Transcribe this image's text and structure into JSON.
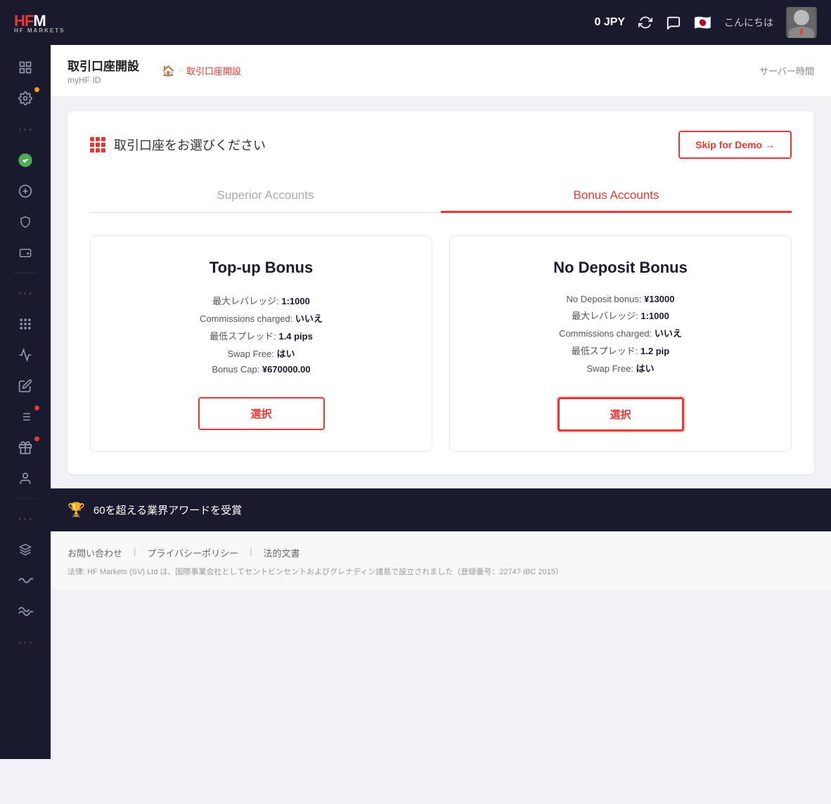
{
  "topnav": {
    "logo_hf": "HF",
    "logo_sub": "HF MARKETS",
    "balance": "0 JPY",
    "greeting": "こんにちは"
  },
  "sidebar": {
    "items": [
      {
        "icon": "📊",
        "name": "analytics-icon",
        "active": false,
        "dot": null
      },
      {
        "icon": "⚙",
        "name": "settings-icon",
        "active": false,
        "dot": "orange"
      },
      {
        "icon": "···",
        "name": "more-dots-icon",
        "active": false,
        "dot": null
      },
      {
        "icon": "🟢",
        "name": "green-account-icon",
        "active": false,
        "dot": null
      },
      {
        "icon": "◯",
        "name": "circle-icon",
        "active": false,
        "dot": null
      },
      {
        "icon": "⊙",
        "name": "lock-icon",
        "active": false,
        "dot": null
      },
      {
        "icon": "🗂",
        "name": "wallet-icon",
        "active": false,
        "dot": null
      },
      {
        "icon": "···",
        "name": "more2-icon",
        "active": false,
        "dot": null
      },
      {
        "icon": "⊞",
        "name": "grid-icon",
        "active": false,
        "dot": null
      },
      {
        "icon": "📈",
        "name": "chart-icon",
        "active": false,
        "dot": null
      },
      {
        "icon": "✏",
        "name": "edit-icon",
        "active": false,
        "dot": null
      },
      {
        "icon": "≡",
        "name": "list-icon",
        "active": false,
        "dot": "red"
      },
      {
        "icon": "🎁",
        "name": "gift-icon",
        "active": false,
        "dot": "red"
      },
      {
        "icon": "👤",
        "name": "user-icon",
        "active": false,
        "dot": null
      },
      {
        "icon": "···",
        "name": "more3-icon",
        "active": false,
        "dot": null
      },
      {
        "icon": "⊕",
        "name": "layers-icon",
        "active": false,
        "dot": null
      },
      {
        "icon": "∿",
        "name": "wave-icon",
        "active": false,
        "dot": null
      },
      {
        "icon": "≈",
        "name": "wave2-icon",
        "active": false,
        "dot": null
      },
      {
        "icon": "···",
        "name": "more4-icon",
        "active": false,
        "dot": null
      }
    ]
  },
  "page": {
    "title": "取引口座開設",
    "subtitle": "myHF ID",
    "breadcrumb_home": "🏠",
    "breadcrumb_sep": "·",
    "breadcrumb_link": "取引口座開設",
    "server_time_label": "サーバー時間"
  },
  "account_section": {
    "title": "取引口座をお選びください",
    "skip_demo_label": "Skip for Demo →",
    "tabs": [
      {
        "label": "Superior Accounts",
        "active": false
      },
      {
        "label": "Bonus Accounts",
        "active": true
      }
    ],
    "accounts": [
      {
        "title": "Top-up Bonus",
        "details": [
          {
            "label": "最大レバレッジ:",
            "value": "1:1000"
          },
          {
            "label": "Commissions charged:",
            "value": "いいえ"
          },
          {
            "label": "最低スプレッド:",
            "value": "1.4 pips"
          },
          {
            "label": "Swap Free:",
            "value": "はい"
          },
          {
            "label": "Bonus Cap:",
            "value": "¥670000.00"
          }
        ],
        "btn_label": "選択",
        "highlighted": false
      },
      {
        "title": "No Deposit Bonus",
        "details": [
          {
            "label": "No Deposit bonus:",
            "value": "¥13000"
          },
          {
            "label": "最大レバレッジ:",
            "value": "1:1000"
          },
          {
            "label": "Commissions charged:",
            "value": "いいえ"
          },
          {
            "label": "最低スプレッド:",
            "value": "1.2 pip"
          },
          {
            "label": "Swap Free:",
            "value": "はい"
          }
        ],
        "btn_label": "選択",
        "highlighted": true
      }
    ]
  },
  "awards_banner": {
    "icon": "🏆",
    "text": "60を超える業界アワードを受賞"
  },
  "footer": {
    "links": [
      "お問い合わせ",
      "プライバシーポリシー",
      "法的文書"
    ],
    "legal": "法律: HF Markets (SV) Ltd は、国際事業会社としてセントビンセントおよびグレナディン諸島で設立されました（登録番号：22747 IBC 2015）"
  }
}
